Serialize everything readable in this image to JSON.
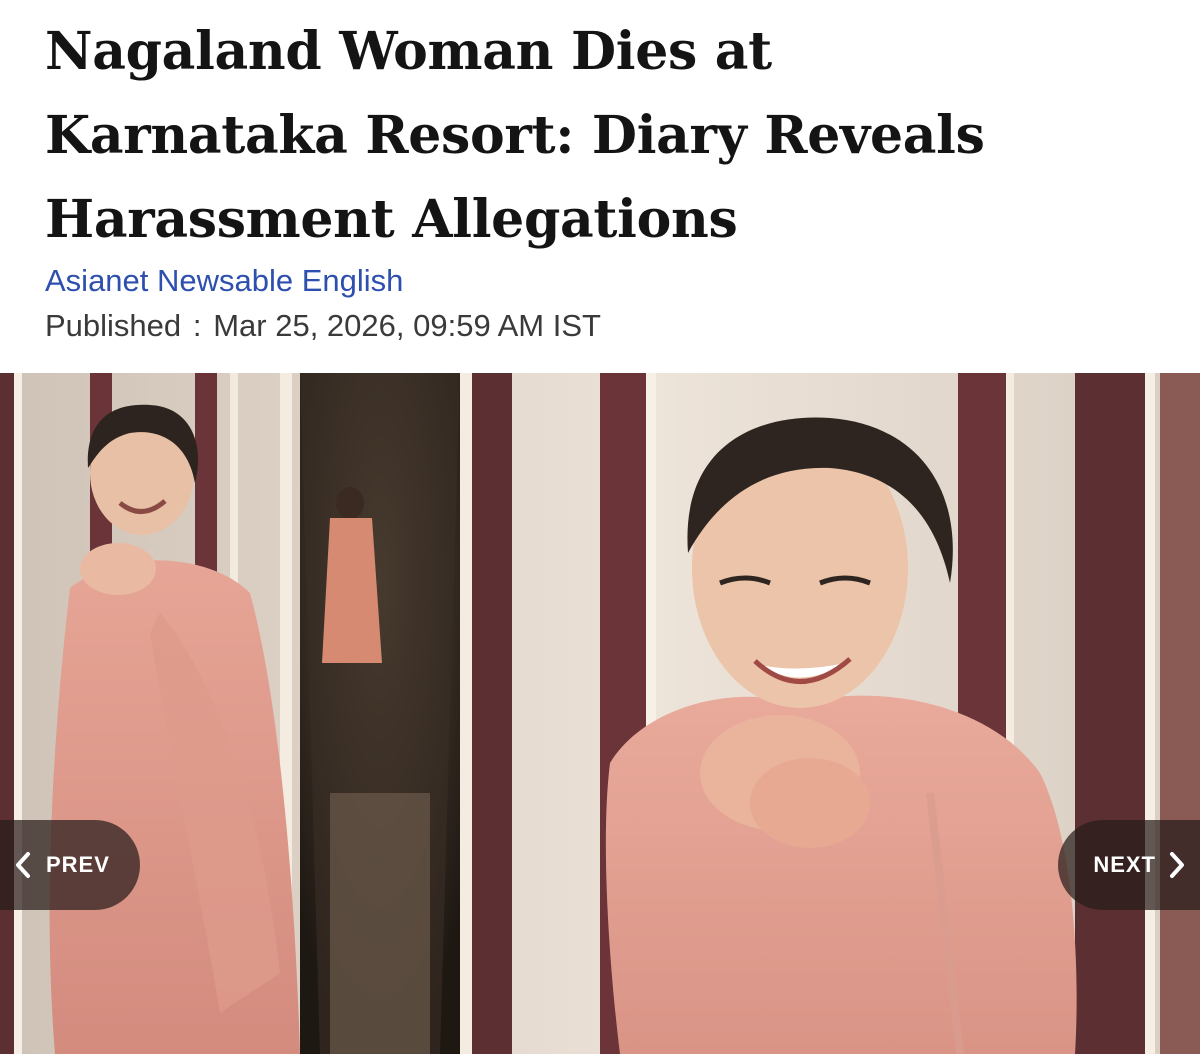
{
  "article": {
    "headline_lines": [
      "Nagaland Woman Dies at",
      "Karnataka Resort: Diary Reveals",
      "Harassment Allegations"
    ],
    "source": "Asianet Newsable English",
    "published_label": "Published",
    "published_separator": ":",
    "published_value": "Mar 25, 2026, 09:59 AM IST"
  },
  "gallery": {
    "prev_label": "PREV",
    "next_label": "NEXT",
    "prev_icon": "chevron-left-icon",
    "next_icon": "chevron-right-icon"
  },
  "colors": {
    "headline": "#141414",
    "source_link": "#2e4fae",
    "meta_text": "#3a3a3a",
    "nav_button_bg": "#281c1a"
  }
}
